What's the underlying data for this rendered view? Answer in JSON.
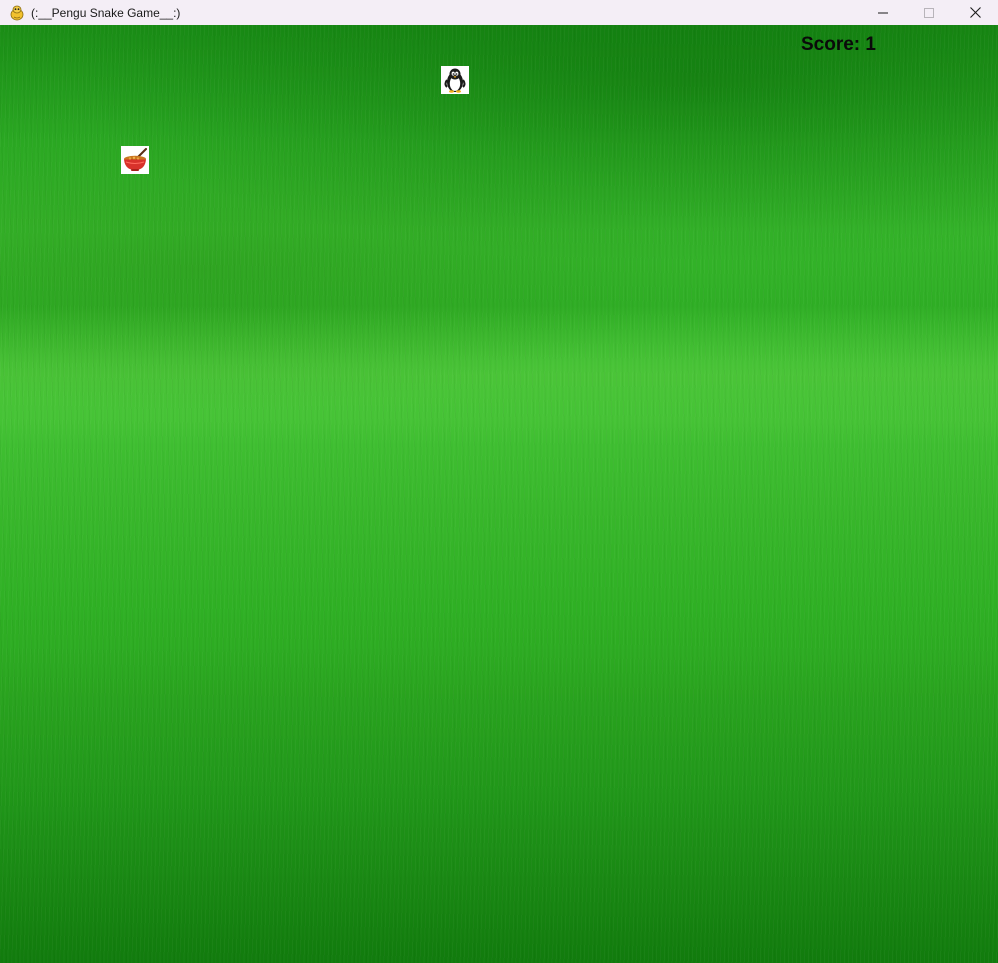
{
  "window": {
    "title": "(:__Pengu Snake Game__:)",
    "controls": {
      "minimize": "minimize",
      "maximize": "maximize",
      "close": "close"
    }
  },
  "game": {
    "score_text": "Score: 1",
    "score": 1,
    "background": "grass-field",
    "player_icon": "penguin-icon",
    "food_icon": "noodle-bowl-icon"
  },
  "colors": {
    "titlebar": "#f4eef6",
    "grass": "#2fae25",
    "score_text": "#0a0a0a"
  }
}
